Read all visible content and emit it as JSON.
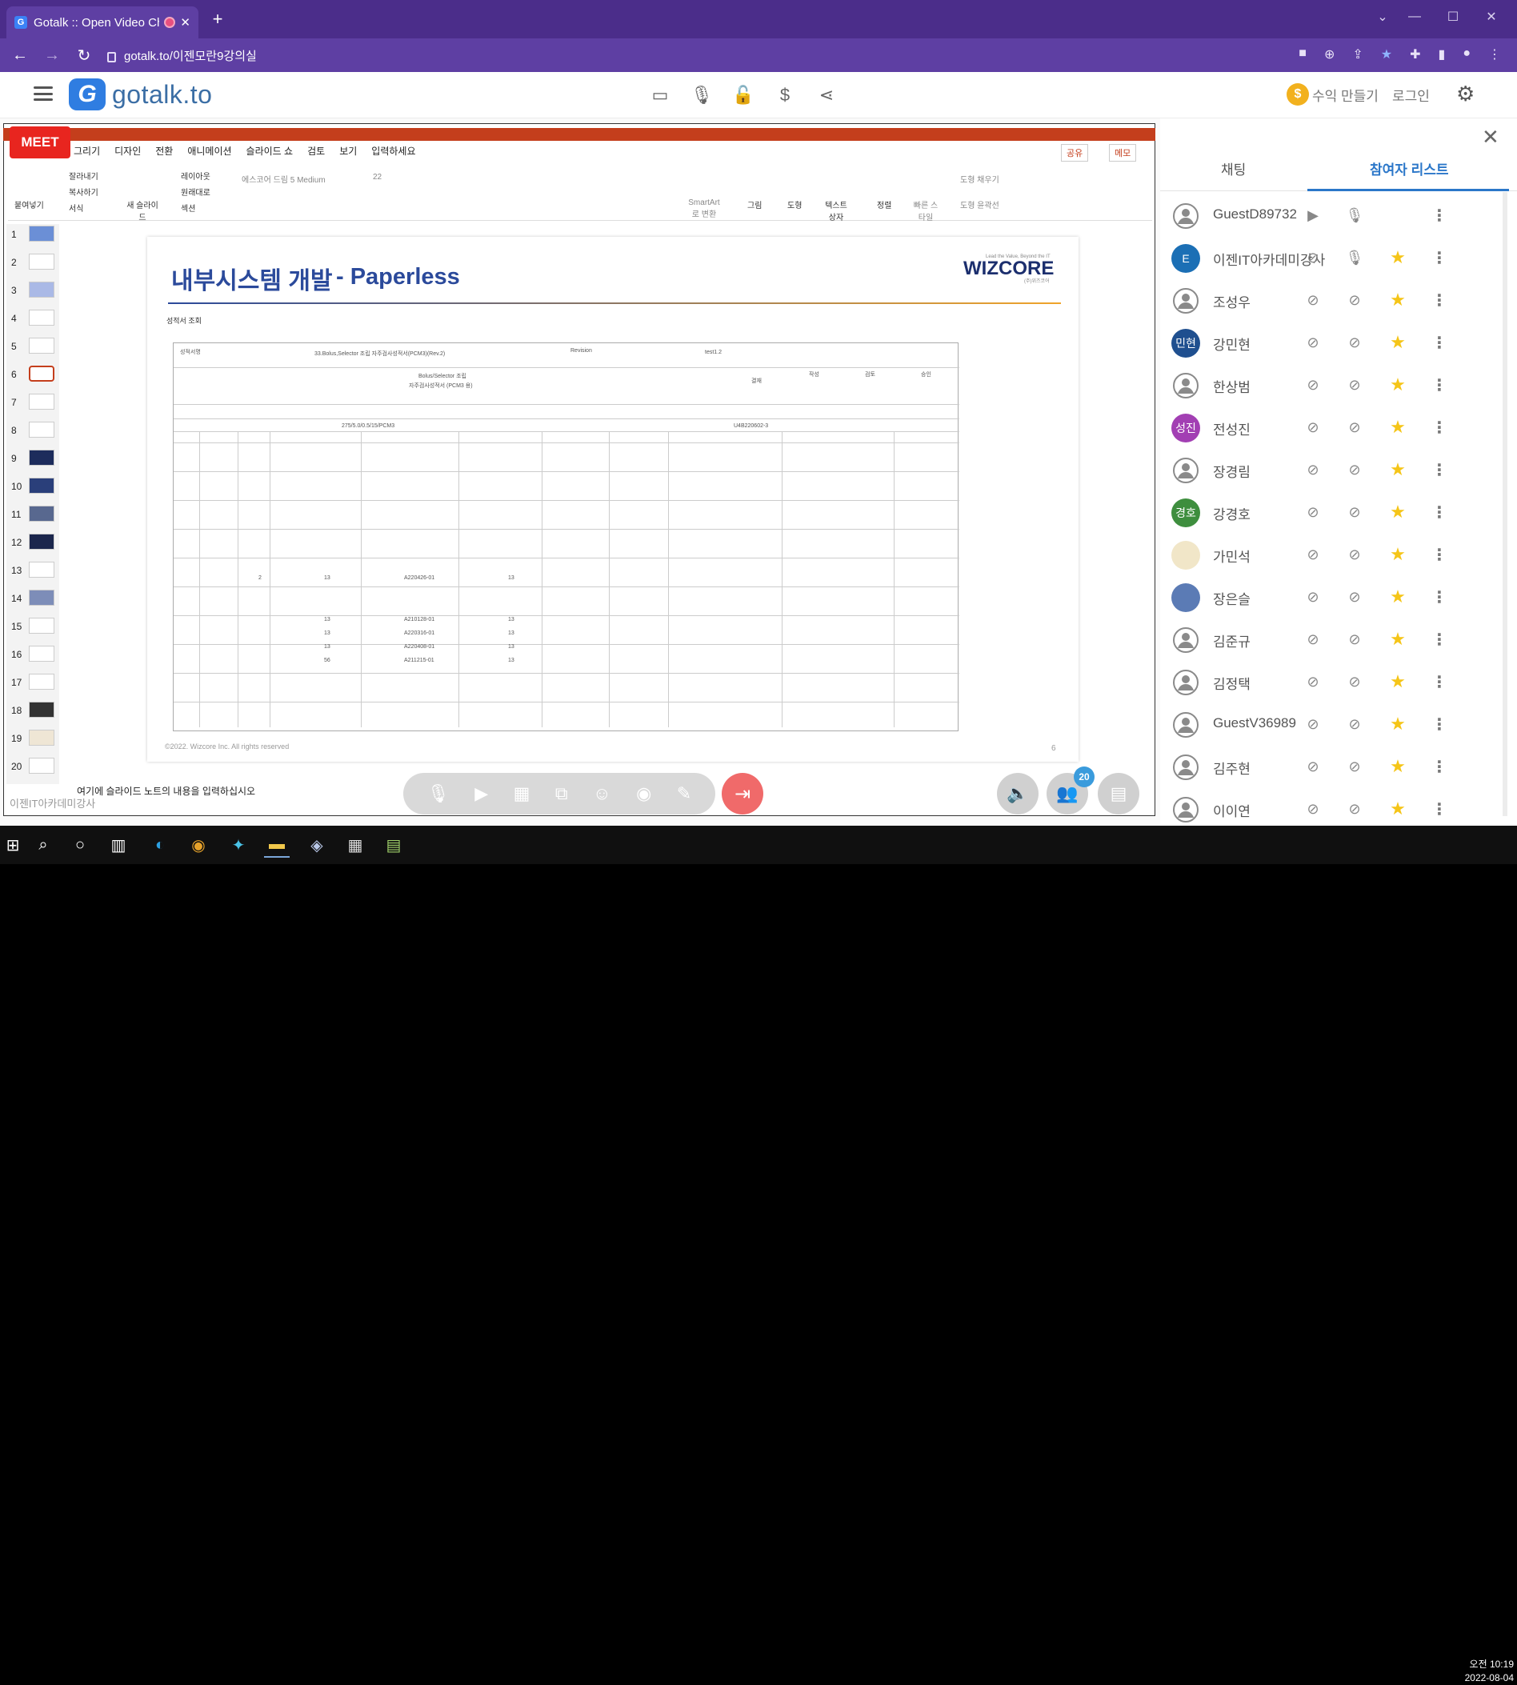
{
  "browser": {
    "tab_title": "Gotalk :: Open Video Chat",
    "url": "gotalk.to/이젠모란9강의실"
  },
  "app": {
    "logo_text": "gotalk.to",
    "earn_label": "수익 만들기",
    "login_label": "로그인"
  },
  "ppt": {
    "meet_label": "MEET",
    "menu": [
      "그리기",
      "디자인",
      "전환",
      "애니메이션",
      "슬라이드 쇼",
      "검토",
      "보기",
      "입력하세요"
    ],
    "share_label": "공유",
    "memo_label": "메모",
    "ribbon": {
      "paste": "붙여넣기",
      "cut": "잘라내기",
      "copy": "복사하기",
      "format": "서식",
      "new_slide": "새 슬라이드",
      "layout": "레이아웃",
      "reset": "원래대로",
      "section": "섹션",
      "font": "에스코어 드림 5 Medium",
      "size": "22",
      "smartart": "SmartArt로 변환",
      "picture": "그림",
      "shape": "도형",
      "textbox": "텍스트 상자",
      "arrange": "정렬",
      "quick": "빠른 스타일",
      "fill": "도형 채우기",
      "outline": "도형 윤곽선"
    },
    "thumbs": [
      "1",
      "2",
      "3",
      "4",
      "5",
      "6",
      "7",
      "8",
      "9",
      "10",
      "11",
      "12",
      "13",
      "14",
      "15",
      "16",
      "17",
      "18",
      "19",
      "20"
    ],
    "notes": "여기에 슬라이드 노트의 내용을 입력하십시오",
    "watermark": "이젠IT아카데미강사"
  },
  "slide": {
    "title_kr": "내부시스템 개발",
    "title_en": "- Paperless",
    "logo": "WIZCORE",
    "logo_tagline": "Lead the Value, Beyond the IT",
    "logo_sub": "(주)위즈코어",
    "form_title": "성적서 조회",
    "form_labels": {
      "cert": "성적서명",
      "cert_val": "33.Bolus,Selector 조립 자주검사성적서(PCM3)(Rev.2)",
      "revision": "Revision",
      "rev_val": "test1.2",
      "doc_title": "Bolus/Selector 조립",
      "doc_title2": "자주검사성적서 (PCM3 용)",
      "approve": "결재",
      "write": "작성",
      "review": "검토",
      "confirm": "승인",
      "model": "275/5.0/0.5/15/PCM3",
      "lot": "U4B220602-3"
    },
    "rows": [
      {
        "lot": "A220426-01",
        "qty1": "2",
        "qty2": "13",
        "qty3": "13"
      },
      {
        "lot": "A210128-01",
        "qty1": "",
        "qty2": "13",
        "qty3": "13"
      },
      {
        "lot": "A220316-01",
        "qty1": "",
        "qty2": "13",
        "qty3": "13"
      },
      {
        "lot": "A220408-01",
        "qty1": "",
        "qty2": "13",
        "qty3": "13"
      },
      {
        "lot": "A211215-01",
        "qty1": "",
        "qty2": "56",
        "qty3": "13"
      }
    ],
    "footer": "©2022. Wizcore Inc. All rights reserved",
    "page": "6"
  },
  "meeting": {
    "participant_count": "20"
  },
  "panel": {
    "tab_chat": "채팅",
    "tab_list": "참여자 리스트",
    "participants": [
      {
        "name": "GuestD89732",
        "avatar": "user",
        "avatar_text": "",
        "cam": "on",
        "mic": "on",
        "star": false
      },
      {
        "name": "이젠IT아카데미강사",
        "avatar": "logo",
        "avatar_text": "E",
        "avatar_color": "#1b6fb5",
        "cam": "off",
        "mic": "on",
        "star": true
      },
      {
        "name": "조성우",
        "avatar": "user",
        "avatar_text": "",
        "cam": "off",
        "mic": "off",
        "star": true
      },
      {
        "name": "강민현",
        "avatar": "text",
        "avatar_text": "민현",
        "avatar_color": "#1f4f8f",
        "cam": "off",
        "mic": "off",
        "star": true
      },
      {
        "name": "한상범",
        "avatar": "user",
        "avatar_text": "",
        "cam": "off",
        "mic": "off",
        "star": true
      },
      {
        "name": "전성진",
        "avatar": "text",
        "avatar_text": "성진",
        "avatar_color": "#a23fb3",
        "cam": "off",
        "mic": "off",
        "star": true
      },
      {
        "name": "장경림",
        "avatar": "user",
        "avatar_text": "",
        "cam": "off",
        "mic": "off",
        "star": true
      },
      {
        "name": "강경호",
        "avatar": "text",
        "avatar_text": "경호",
        "avatar_color": "#3e8e3e",
        "cam": "off",
        "mic": "off",
        "star": true
      },
      {
        "name": "가민석",
        "avatar": "image",
        "avatar_text": "",
        "avatar_color": "#f1e6c8",
        "cam": "off",
        "mic": "off",
        "star": true
      },
      {
        "name": "장은슬",
        "avatar": "image",
        "avatar_text": "",
        "avatar_color": "#5b7bb5",
        "cam": "off",
        "mic": "off",
        "star": true
      },
      {
        "name": "김준규",
        "avatar": "user",
        "avatar_text": "",
        "cam": "off",
        "mic": "off",
        "star": true
      },
      {
        "name": "김정택",
        "avatar": "user",
        "avatar_text": "",
        "cam": "off",
        "mic": "off",
        "star": true
      },
      {
        "name": "GuestV36989",
        "avatar": "user",
        "avatar_text": "",
        "cam": "off",
        "mic": "off",
        "star": true
      },
      {
        "name": "김주현",
        "avatar": "user",
        "avatar_text": "",
        "cam": "off",
        "mic": "off",
        "star": true
      },
      {
        "name": "이이연",
        "avatar": "user",
        "avatar_text": "",
        "cam": "off",
        "mic": "off",
        "star": true
      }
    ]
  },
  "clock": {
    "time": "오전 10:19",
    "date": "2022-08-04"
  },
  "colors": {
    "browser": "#4b2d8a",
    "accent": "#2b77c9",
    "star": "#f5c518",
    "leave": "#f06a6a",
    "meet": "#e8251f"
  }
}
